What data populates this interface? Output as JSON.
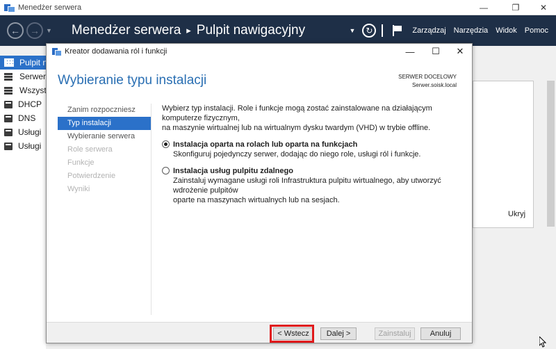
{
  "window": {
    "title": "Menedżer serwera",
    "minimize": "—",
    "maximize": "❐",
    "close": "✕"
  },
  "header": {
    "app_name": "Menedżer serwera",
    "breadcrumb_separator": "▸",
    "page": "Pulpit nawigacyjny",
    "menu": [
      "Zarządzaj",
      "Narzędzia",
      "Widok",
      "Pomoc"
    ]
  },
  "sidebar": {
    "items": [
      {
        "label": "Pulpit n",
        "icon": "dashboard-grid-icon",
        "active": true
      },
      {
        "label": "Serwer",
        "icon": "server-icon"
      },
      {
        "label": "Wszyst",
        "icon": "servers-icon"
      },
      {
        "label": "DHCP",
        "icon": "role-icon"
      },
      {
        "label": "DNS",
        "icon": "role-icon"
      },
      {
        "label": "Usługi",
        "icon": "role-icon"
      },
      {
        "label": "Usługi",
        "icon": "role-icon"
      }
    ]
  },
  "background_panel": {
    "hide_link": "Ukryj"
  },
  "dialog": {
    "title": "Kreator dodawania ról i funkcji",
    "page_title": "Wybieranie typu instalacji",
    "destination_label": "SERWER DOCELOWY",
    "destination_server": "Serwer.soisk.local",
    "steps": [
      {
        "label": "Zanim rozpoczniesz",
        "state": "normal"
      },
      {
        "label": "Typ instalacji",
        "state": "active"
      },
      {
        "label": "Wybieranie serwera",
        "state": "normal"
      },
      {
        "label": "Role serwera",
        "state": "disabled"
      },
      {
        "label": "Funkcje",
        "state": "disabled"
      },
      {
        "label": "Potwierdzenie",
        "state": "disabled"
      },
      {
        "label": "Wyniki",
        "state": "disabled"
      }
    ],
    "intro_line1": "Wybierz typ instalacji. Role i funkcje mogą zostać zainstalowane na działającym komputerze fizycznym,",
    "intro_line2": "na maszynie wirtualnej lub na wirtualnym dysku twardym (VHD) w trybie offline.",
    "options": [
      {
        "label": "Instalacja oparta na rolach lub oparta na funkcjach",
        "desc1": "Skonfiguruj pojedynczy serwer, dodając do niego role, usługi ról i funkcje.",
        "desc2": "",
        "selected": true
      },
      {
        "label": "Instalacja usług pulpitu zdalnego",
        "desc1": "Zainstaluj wymagane usługi roli Infrastruktura pulpitu wirtualnego, aby utworzyć wdrożenie pulpitów",
        "desc2": "oparte na maszynach wirtualnych lub na sesjach.",
        "selected": false
      }
    ],
    "buttons": {
      "previous": "< Wstecz",
      "next": "Dalej >",
      "install": "Zainstaluj",
      "cancel": "Anuluj"
    },
    "highlight_color": "#e0191b"
  },
  "colors": {
    "header_bg": "#1e2f47",
    "accent": "#2b71c9",
    "title_blue": "#2a6fb3"
  }
}
